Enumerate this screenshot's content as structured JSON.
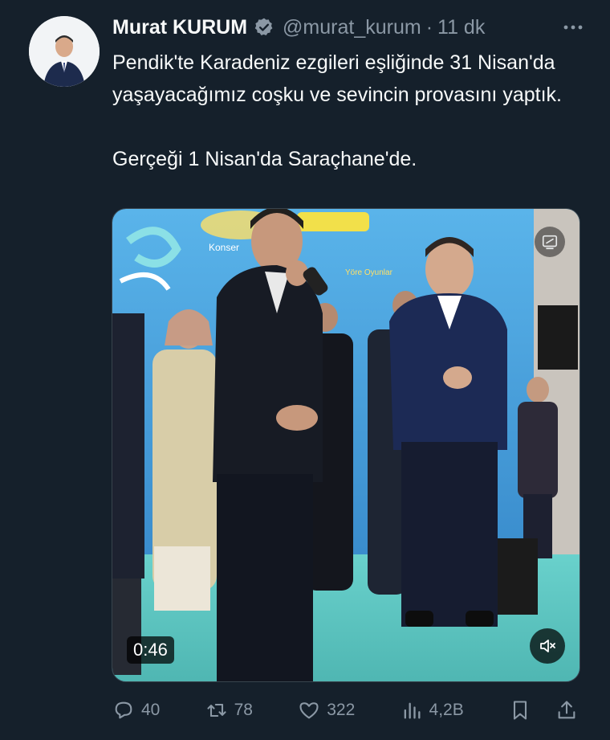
{
  "author": {
    "display_name": "Murat KURUM",
    "handle": "@murat_kurum",
    "separator": "·",
    "time": "11 dk",
    "verified": true
  },
  "tweet": {
    "lines": [
      "Pendik'te Karadeniz ezgileri eşliğinde 31 Nisan'da yaşayacağımız coşku ve sevincin provasını yaptık.",
      "Gerçeği 1 Nisan'da Saraçhane'de."
    ]
  },
  "media": {
    "type": "video",
    "duration": "0:46",
    "banner_text": [
      "Konser",
      "Yöre Oyunlar"
    ]
  },
  "actions": {
    "replies": "40",
    "retweets": "78",
    "likes": "322",
    "views": "4,2B"
  },
  "icons": {
    "verified": "verified-badge-icon",
    "more": "more-dots-icon",
    "reply": "reply-icon",
    "retweet": "retweet-icon",
    "like": "heart-icon",
    "views": "views-icon",
    "bookmark": "bookmark-icon",
    "share": "share-icon",
    "mute": "muted-speaker-icon",
    "download": "media-settings-icon"
  },
  "colors": {
    "background": "#15202b",
    "text": "#f7f9f9",
    "muted": "#8b98a5",
    "stage_floor": "#5fc9c4",
    "backdrop": "#3aa7e0"
  }
}
